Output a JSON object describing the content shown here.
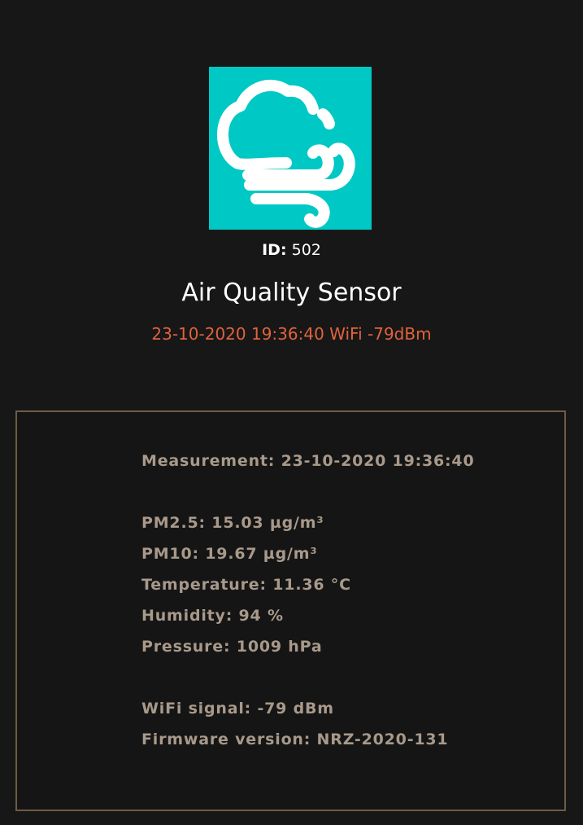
{
  "colors": {
    "background": "#171717",
    "icon_background": "#00c8c4",
    "status_text": "#e0633c",
    "panel_border": "#6e5b46",
    "panel_text": "#a8998a"
  },
  "header": {
    "icon": "cloud-wind-icon",
    "id_label": "ID:",
    "id_value": "502",
    "title": "Air Quality Sensor",
    "status": "23-10-2020 19:36:40 WiFi -79dBm"
  },
  "details": {
    "measurement": "Measurement: 23-10-2020 19:36:40",
    "pm25": "PM2.5: 15.03 µg/m³",
    "pm10": "PM10: 19.67 µg/m³",
    "temperature": "Temperature: 11.36 °C",
    "humidity": "Humidity: 94 %",
    "pressure": "Pressure: 1009 hPa",
    "wifi_signal": "WiFi signal: -79 dBm",
    "firmware": "Firmware version: NRZ-2020-131"
  }
}
